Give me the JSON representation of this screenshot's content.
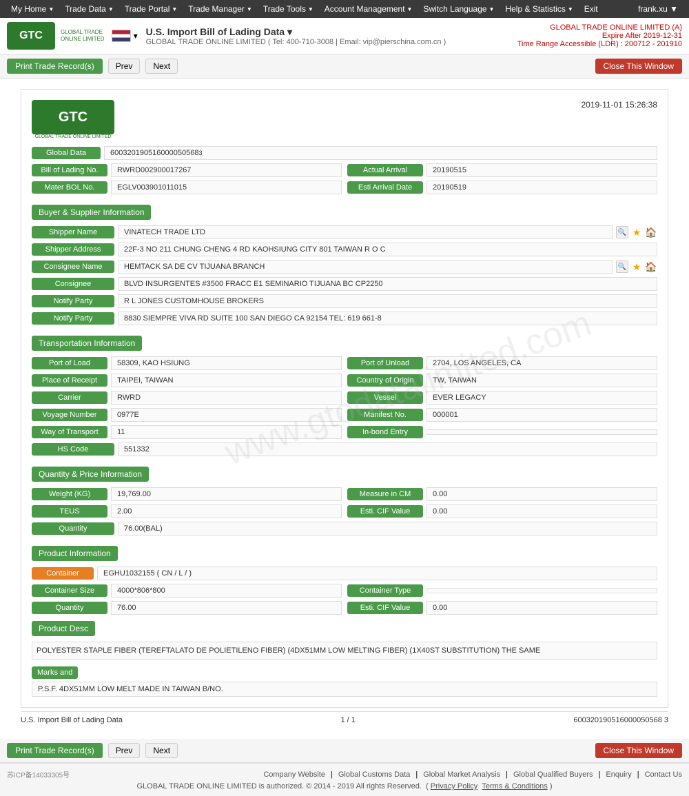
{
  "nav": {
    "items": [
      {
        "label": "My Home",
        "has_caret": true
      },
      {
        "label": "Trade Data",
        "has_caret": true
      },
      {
        "label": "Trade Portal",
        "has_caret": true
      },
      {
        "label": "Trade Manager",
        "has_caret": true
      },
      {
        "label": "Trade Tools",
        "has_caret": true
      },
      {
        "label": "Account Management",
        "has_caret": true
      },
      {
        "label": "Switch Language",
        "has_caret": true
      },
      {
        "label": "Help & Statistics",
        "has_caret": true
      },
      {
        "label": "Exit",
        "has_caret": false
      }
    ],
    "user": "frank.xu ▼"
  },
  "header": {
    "company_title": "U.S. Import Bill of Lading Data ▾",
    "company_subtitle": "GLOBAL TRADE ONLINE LIMITED ( Tel: 400-710-3008 | Email: vip@pierschina.com.cn )",
    "right_line1": "GLOBAL TRADE ONLINE LIMITED (A)",
    "right_line2": "Expire After 2019-12-31",
    "right_line3": "Time Range Accessible (LDR) : 200712 - 201910"
  },
  "actions": {
    "print_btn": "Print Trade Record(s)",
    "prev_btn": "Prev",
    "next_btn": "Next",
    "close_btn": "Close This Window"
  },
  "record": {
    "datetime": "2019-11-01 15:26:38",
    "global_data_label": "Global Data",
    "global_data_value": "600320190516000050568 3",
    "bol_label": "Bill of Lading No.",
    "bol_value": "RWRD002900017267",
    "actual_arrival_label": "Actual Arrival",
    "actual_arrival_value": "20190515",
    "master_bol_label": "Mater BOL No.",
    "master_bol_value": "EGLV003901011015",
    "esti_arrival_label": "Esti Arrival Date",
    "esti_arrival_value": "20190519"
  },
  "buyer_supplier": {
    "section_label": "Buyer & Supplier Information",
    "shipper_name_label": "Shipper Name",
    "shipper_name_value": "VINATECH TRADE LTD",
    "shipper_address_label": "Shipper Address",
    "shipper_address_value": "22F-3 NO 211 CHUNG CHENG 4 RD KAOHSIUNG CITY 801 TAIWAN R O C",
    "consignee_name_label": "Consignee Name",
    "consignee_name_value": "HEMTACK SA DE CV TIJUANA BRANCH",
    "consignee_label": "Consignee",
    "consignee_value": "BLVD INSURGENTES #3500 FRACC E1 SEMINARIO TIJUANA BC CP2250",
    "notify_party1_label": "Notify Party",
    "notify_party1_value": "R L JONES CUSTOMHOUSE BROKERS",
    "notify_party2_label": "Notify Party",
    "notify_party2_value": "8830 SIEMPRE VIVA RD SUITE 100 SAN DIEGO CA 92154 TEL: 619 661-8"
  },
  "transportation": {
    "section_label": "Transportation Information",
    "port_of_load_label": "Port of Load",
    "port_of_load_value": "58309, KAO HSIUNG",
    "port_of_unload_label": "Port of Unload",
    "port_of_unload_value": "2704, LOS ANGELES, CA",
    "place_of_receipt_label": "Place of Receipt",
    "place_of_receipt_value": "TAIPEI, TAIWAN",
    "country_of_origin_label": "Country of Origin",
    "country_of_origin_value": "TW, TAIWAN",
    "carrier_label": "Carrier",
    "carrier_value": "RWRD",
    "vessel_label": "Vessel",
    "vessel_value": "EVER LEGACY",
    "voyage_label": "Voyage Number",
    "voyage_value": "0977E",
    "manifest_label": "Manifest No.",
    "manifest_value": "000001",
    "way_of_transport_label": "Way of Transport",
    "way_of_transport_value": "11",
    "in_bond_entry_label": "In-bond Entry",
    "in_bond_entry_value": "",
    "hs_code_label": "HS Code",
    "hs_code_value": "551332"
  },
  "quantity_price": {
    "section_label": "Quantity & Price Information",
    "weight_label": "Weight (KG)",
    "weight_value": "19,769.00",
    "measure_label": "Measure in CM",
    "measure_value": "0.00",
    "teus_label": "TEUS",
    "teus_value": "2.00",
    "esti_cif_label": "Esti. CIF Value",
    "esti_cif_value": "0.00",
    "quantity_label": "Quantity",
    "quantity_value": "76.00(BAL)"
  },
  "product_info": {
    "section_label": "Product Information",
    "container_label": "Container",
    "container_value": "EGHU1032155 ( CN / L / )",
    "container_size_label": "Container Size",
    "container_size_value": "4000*806*800",
    "container_type_label": "Container Type",
    "container_type_value": "",
    "quantity_label": "Quantity",
    "quantity_value": "76.00",
    "esti_cif_label": "Esti. CIF Value",
    "esti_cif_value": "0.00",
    "product_desc_label": "Product Desc",
    "product_desc_value": "POLYESTER STAPLE FIBER (TEREFTALATO DE POLIETILENO FIBER) (4DX51MM LOW MELTING FIBER) (1X40ST SUBSTITUTION) THE SAME",
    "marks_label": "Marks and",
    "marks_value": "P.S.F. 4DX51MM LOW MELT MADE IN TAIWAN B/NO."
  },
  "bottom": {
    "data_source": "U.S. Import Bill of Lading Data",
    "page_info": "1 / 1",
    "record_id": "600320190516000050568 3"
  },
  "footer": {
    "icp": "苏ICP备14033305号",
    "links": [
      "Company Website",
      "Global Customs Data",
      "Global Market Analysis",
      "Global Qualified Buyers",
      "Enquiry",
      "Contact Us"
    ],
    "copyright": "GLOBAL TRADE ONLINE LIMITED is authorized. © 2014 - 2019 All rights Reserved.",
    "legal_links": [
      "Privacy Policy",
      "Terms & Conditions"
    ]
  }
}
